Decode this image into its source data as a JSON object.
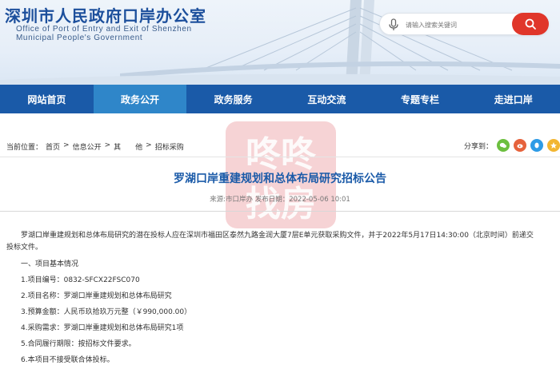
{
  "header": {
    "title_cn": "深圳市人民政府口岸办公室",
    "title_en_line1": "Office of Port of Entry and Exit of Shenzhen",
    "title_en_line2": "Municipal People's Government",
    "search_placeholder": "请输入搜索关键词"
  },
  "nav": {
    "items": [
      {
        "label": "网站首页"
      },
      {
        "label": "政务公开"
      },
      {
        "label": "政务服务"
      },
      {
        "label": "互动交流"
      },
      {
        "label": "专题专栏"
      },
      {
        "label": "走进口岸"
      }
    ],
    "active_index": 1,
    "colors": {
      "bar": "#1a5aa8",
      "active": "#2f86c9"
    }
  },
  "breadcrumb": {
    "prefix": "当前位置：",
    "items": [
      "首页",
      "信息公开",
      "其　　他",
      "招标采购"
    ],
    "separator": ">"
  },
  "share": {
    "label": "分享到：",
    "icons": [
      {
        "name": "wechat-icon",
        "color": "#6cbf3f"
      },
      {
        "name": "weibo-icon",
        "color": "#e6623c"
      },
      {
        "name": "qq-icon",
        "color": "#2d9be6"
      },
      {
        "name": "qzone-icon",
        "color": "#f2b632"
      }
    ]
  },
  "article": {
    "title": "罗湖口岸重建规划和总体布局研究招标公告",
    "meta": "来源:市口岸办 发布日期：2022-05-06 10:01",
    "intro_line1": "罗湖口岸重建规划和总体布局研究的潜在投标人应在深圳市福田区泰然九路金润大厦7层E单元获取采购文件，并于2022年5月17日14:30:00（北京时间）前递交",
    "intro_line2": "投标文件。",
    "section1": "一、项目基本情况",
    "items": [
      "1.项目编号：0832-SFCX22FSC070",
      "2.项目名称：罗湖口岸重建规划和总体布局研究",
      "3.预算金额：人民币玖拾玖万元整（￥990,000.00）",
      "4.采购需求：罗湖口岸重建规划和总体布局研究1项",
      "5.合同履行期限：按招标文件要求。",
      "6.本项目不接受联合体投标。"
    ]
  },
  "watermark": {
    "text_top": "咚咚",
    "text_bottom": "找房"
  }
}
